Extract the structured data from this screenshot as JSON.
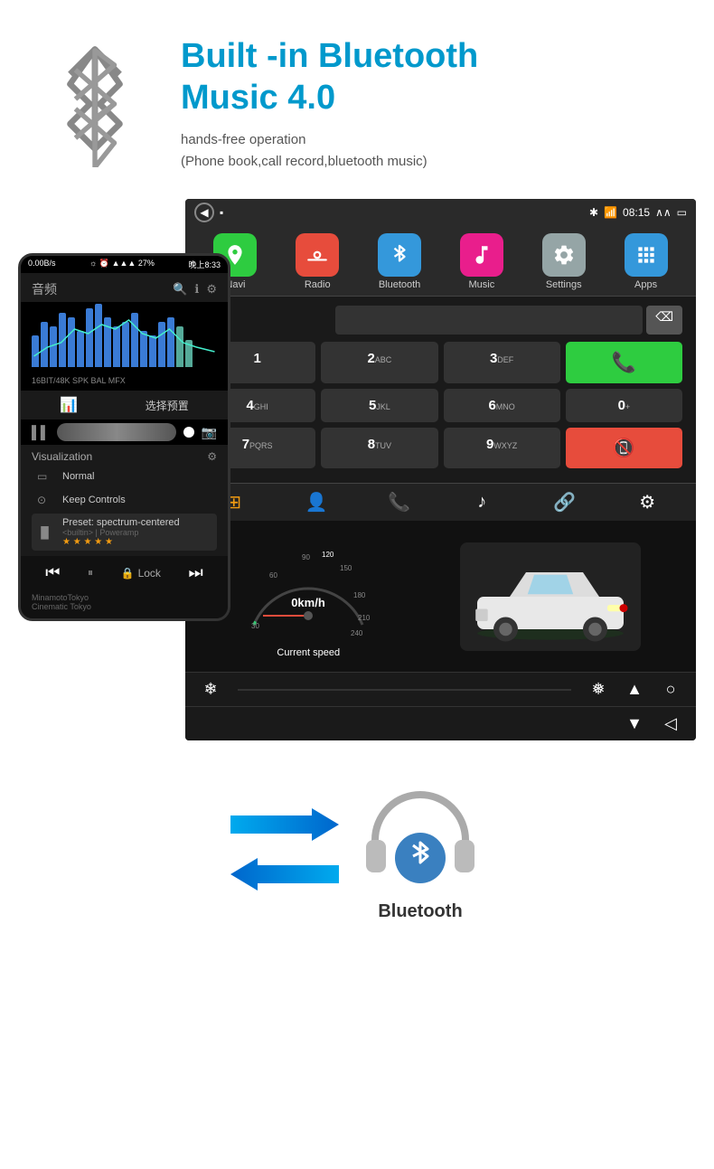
{
  "header": {
    "title": "Built -in Bluetooth\nMusic 4.0",
    "subtitle1": "hands-free operation",
    "subtitle2": "(Phone book,call record,bluetooth music)"
  },
  "app_icons": [
    {
      "label": "Navi",
      "color": "icon-navi",
      "symbol": "📍"
    },
    {
      "label": "Radio",
      "color": "icon-radio",
      "symbol": "📻"
    },
    {
      "label": "Bluetooth",
      "color": "icon-bluetooth",
      "symbol": "🔷"
    },
    {
      "label": "Music",
      "color": "icon-music",
      "symbol": "🎵"
    },
    {
      "label": "Settings",
      "color": "icon-settings",
      "symbol": "⚙️"
    },
    {
      "label": "Apps",
      "color": "icon-apps",
      "symbol": "⊞"
    }
  ],
  "status_bar": {
    "time": "08:15"
  },
  "keypad": {
    "keys": [
      {
        "main": "1",
        "sub": ""
      },
      {
        "main": "2",
        "sub": "ABC"
      },
      {
        "main": "3",
        "sub": "DEF"
      },
      {
        "main": "*",
        "sub": ""
      },
      {
        "main": "4",
        "sub": "GHI"
      },
      {
        "main": "5",
        "sub": "JKL"
      },
      {
        "main": "6",
        "sub": "MNO"
      },
      {
        "main": "0",
        "sub": "+"
      },
      {
        "main": "7",
        "sub": "PQRS"
      },
      {
        "main": "8",
        "sub": "TUV"
      },
      {
        "main": "9",
        "sub": "WXYZ"
      },
      {
        "main": "#",
        "sub": ""
      }
    ]
  },
  "dashboard": {
    "speed": "0km/h",
    "speed_label": "Current speed"
  },
  "phone": {
    "status": "0.00B/s",
    "time": "晚上8:33",
    "battery": "27%",
    "header_label": "音频",
    "bit_info": "16BIT/48K SPK BAL MFX",
    "preset_label": "选择预置",
    "viz_label": "Visualization",
    "normal": "Normal",
    "keep_controls": "Keep Controls",
    "preset": "Preset: spectrum-centered",
    "preset_sub": "<builtin> | Poweramp",
    "lock_label": "Lock"
  },
  "bottom": {
    "bluetooth_label": "Bluetooth"
  }
}
